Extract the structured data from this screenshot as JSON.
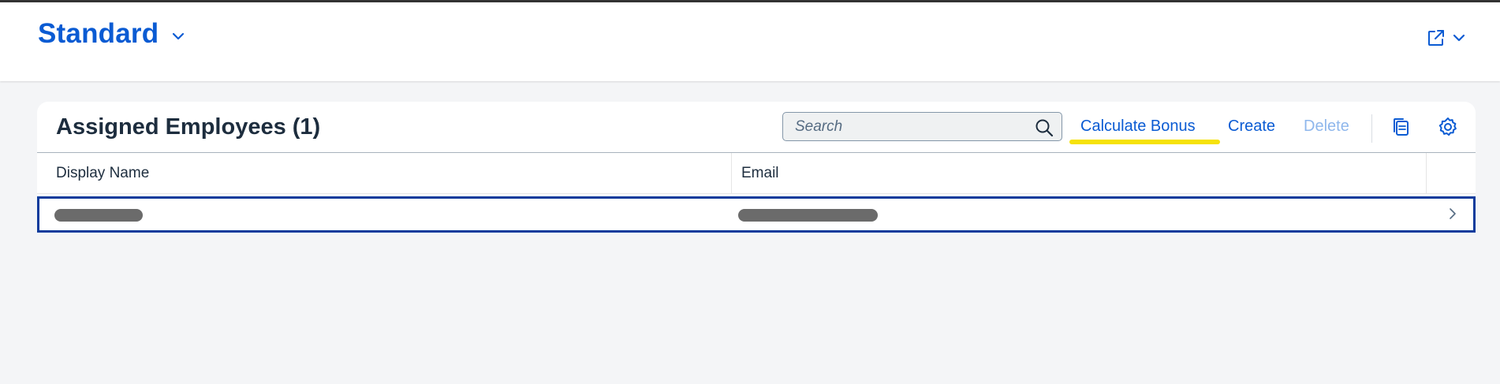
{
  "header": {
    "variant_title": "Standard",
    "icons": [
      "chevron-down-icon",
      "share-icon"
    ]
  },
  "table_toolbar": {
    "title": "Assigned Employees (1)",
    "search": {
      "placeholder": "Search",
      "value": ""
    },
    "buttons": {
      "calculate_bonus": "Calculate Bonus",
      "create": "Create",
      "delete": "Delete"
    },
    "icons": [
      "search-icon",
      "copy-icon",
      "settings-icon"
    ]
  },
  "table": {
    "columns": [
      "Display Name",
      "Email"
    ],
    "rows": [
      {
        "display_name": "[redacted]",
        "email": "[redacted]"
      }
    ]
  },
  "colors": {
    "accent": "#0a5bd3",
    "disabled_text": "#8fb7ec",
    "selection_border": "#0a3b9c",
    "highlight": "#f6e20b",
    "background": "#f4f5f7"
  }
}
